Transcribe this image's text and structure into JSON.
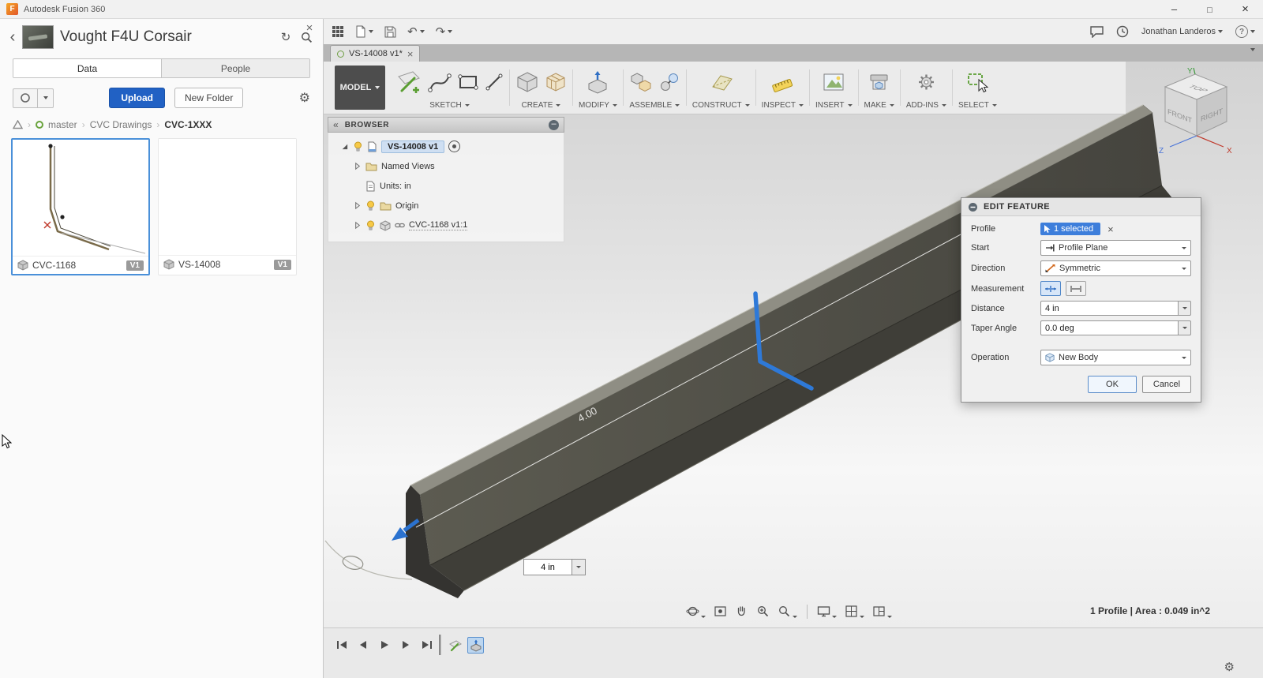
{
  "titlebar": {
    "app_title": "Autodesk Fusion 360"
  },
  "appbar": {
    "user_name": "Jonathan Landeros",
    "help_label": "?"
  },
  "data_panel": {
    "project_title": "Vought F4U Corsair",
    "tabs": [
      {
        "label": "Data"
      },
      {
        "label": "People"
      }
    ],
    "upload_label": "Upload",
    "new_folder_label": "New Folder",
    "breadcrumb": [
      "master",
      "CVC Drawings",
      "CVC-1XXX"
    ],
    "items": [
      {
        "name": "CVC-1168",
        "version": "V1",
        "selected": true
      },
      {
        "name": "VS-14008",
        "version": "V1",
        "selected": false
      }
    ]
  },
  "tabstrip": {
    "document_tab": "VS-14008 v1*"
  },
  "ribbon": {
    "workspace_label": "MODEL",
    "groups": [
      {
        "label": "SKETCH"
      },
      {
        "label": "CREATE"
      },
      {
        "label": "MODIFY"
      },
      {
        "label": "ASSEMBLE"
      },
      {
        "label": "CONSTRUCT"
      },
      {
        "label": "INSPECT"
      },
      {
        "label": "INSERT"
      },
      {
        "label": "MAKE"
      },
      {
        "label": "ADD-INS"
      },
      {
        "label": "SELECT"
      }
    ]
  },
  "browser": {
    "title": "BROWSER",
    "root_label": "VS-14008 v1",
    "items": [
      {
        "label": "Named Views"
      },
      {
        "label": "Units: in"
      },
      {
        "label": "Origin"
      },
      {
        "label": "CVC-1168 v1:1"
      }
    ]
  },
  "viewcube": {
    "top": "TOP",
    "front": "FRONT",
    "right": "RIGHT",
    "axis_x": "X",
    "axis_y": "Y",
    "axis_z": "Z"
  },
  "viewport": {
    "dimension_label": "4.00",
    "distance_value": "4 in",
    "status_text": "1 Profile | Area : 0.049 in^2"
  },
  "edit_feature_dialog": {
    "title": "EDIT FEATURE",
    "profile_label": "Profile",
    "profile_value": "1 selected",
    "start_label": "Start",
    "start_value": "Profile Plane",
    "direction_label": "Direction",
    "direction_value": "Symmetric",
    "measurement_label": "Measurement",
    "distance_label": "Distance",
    "distance_value": "4 in",
    "taper_label": "Taper Angle",
    "taper_value": "0.0 deg",
    "operation_label": "Operation",
    "operation_value": "New Body",
    "ok_label": "OK",
    "cancel_label": "Cancel"
  },
  "colors": {
    "accent_blue": "#3a7bd5",
    "upload_blue": "#2161c4",
    "selection_blue": "#4a90d9",
    "model_button_dark": "#4d4d4d",
    "part_face": "#514f46",
    "profile_highlight": "#2e79d8"
  }
}
